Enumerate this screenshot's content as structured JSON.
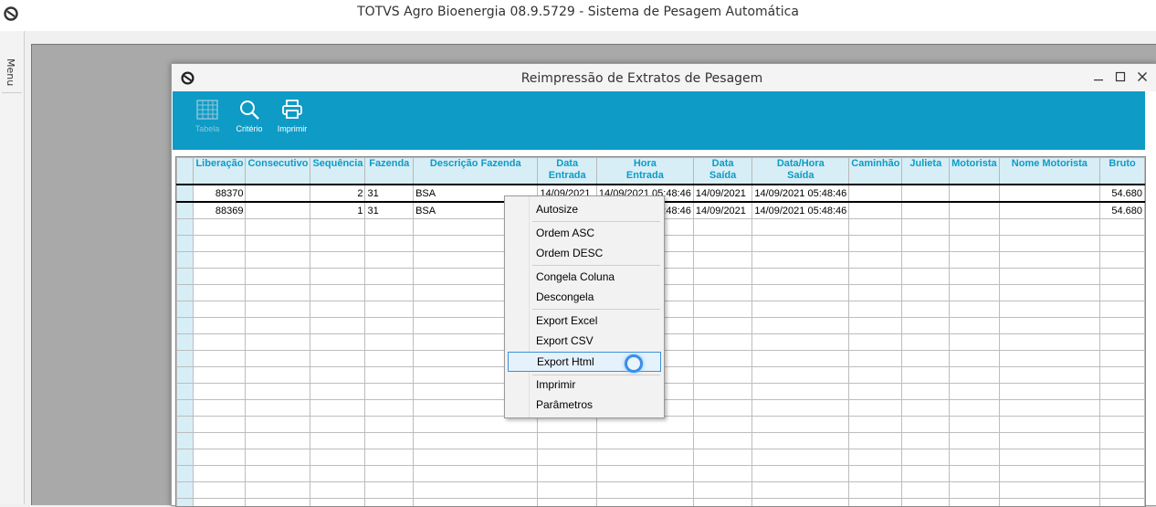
{
  "app": {
    "title": "TOTVS Agro Bioenergia 08.9.5729 - Sistema de Pesagem Automática"
  },
  "side_menu": {
    "label": "Menu"
  },
  "window": {
    "title": "Reimpressão de Extratos de Pesagem"
  },
  "toolbar": {
    "tabela_label": "Tabela",
    "criterio_label": "Critério",
    "imprimir_label": "Imprimir",
    "tabela_icon": "table-icon",
    "criterio_icon": "search-icon",
    "imprimir_icon": "printer-icon"
  },
  "grid": {
    "columns": [
      {
        "line1": "Liberação",
        "line2": ""
      },
      {
        "line1": "Consecutivo",
        "line2": ""
      },
      {
        "line1": "Sequência",
        "line2": ""
      },
      {
        "line1": "Fazenda",
        "line2": ""
      },
      {
        "line1": "Descrição Fazenda",
        "line2": ""
      },
      {
        "line1": "Data",
        "line2": "Entrada"
      },
      {
        "line1": "Hora",
        "line2": "Entrada"
      },
      {
        "line1": "Data",
        "line2": "Saída"
      },
      {
        "line1": "Data/Hora",
        "line2": "Saída"
      },
      {
        "line1": "Caminhão",
        "line2": ""
      },
      {
        "line1": "Julieta",
        "line2": ""
      },
      {
        "line1": "Motorista",
        "line2": ""
      },
      {
        "line1": "Nome Motorista",
        "line2": ""
      },
      {
        "line1": "Bruto",
        "line2": ""
      }
    ],
    "rows": [
      [
        "88370",
        "",
        "2",
        "31",
        "BSA",
        "14/09/2021",
        "14/09/2021 05:48:46",
        "14/09/2021",
        "14/09/2021 05:48:46",
        "",
        "",
        "",
        "",
        "54.680"
      ],
      [
        "88369",
        "",
        "1",
        "31",
        "BSA",
        "",
        "5:48:46",
        "14/09/2021",
        "14/09/2021 05:48:46",
        "",
        "",
        "",
        "",
        "54.680"
      ]
    ]
  },
  "context_menu": {
    "items": [
      "Autosize",
      "Ordem ASC",
      "Ordem DESC",
      "Congela Coluna",
      "Descongela",
      "Export Excel",
      "Export CSV",
      "Export Html",
      "Imprimir",
      "Parâmetros"
    ],
    "hovered": "Export Html"
  }
}
